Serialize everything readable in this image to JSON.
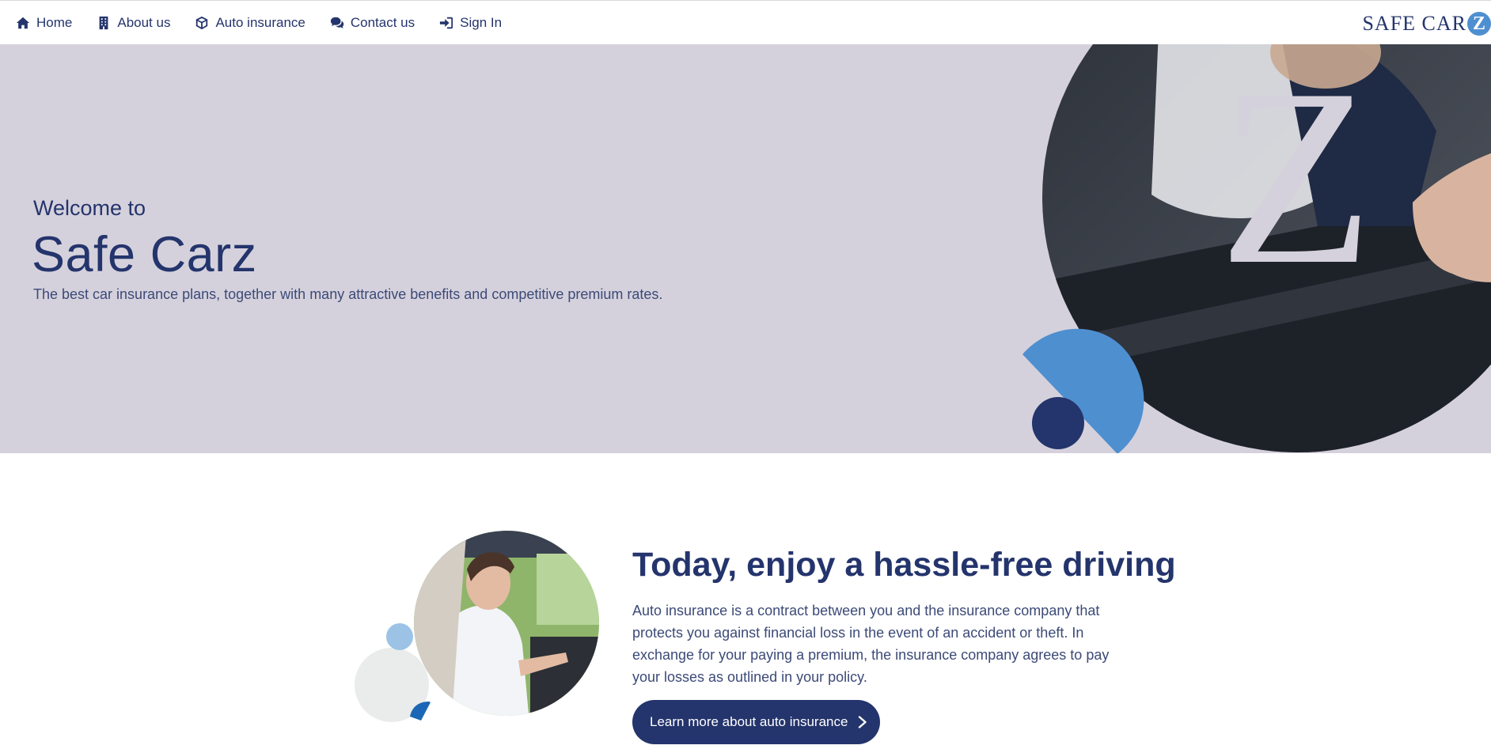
{
  "nav": {
    "items": [
      {
        "label": "Home",
        "icon": "home-icon"
      },
      {
        "label": "About us",
        "icon": "building-icon"
      },
      {
        "label": "Auto insurance",
        "icon": "cube-icon"
      },
      {
        "label": "Contact us",
        "icon": "comments-icon"
      },
      {
        "label": "Sign In",
        "icon": "sign-in-icon"
      }
    ]
  },
  "logo": {
    "text": "SAFE CAR",
    "badge": "Z"
  },
  "hero": {
    "welcome": "Welcome to",
    "title": "Safe Carz",
    "subtitle": "The best car insurance plans, together with many attractive benefits and competitive premium rates."
  },
  "section": {
    "title": "Today, enjoy a hassle-free driving",
    "body": "Auto insurance is a contract between you and the insurance company that protects you against financial loss in the event of an accident or theft. In exchange for your paying a premium, the insurance company agrees to pay your losses as outlined in your policy.",
    "cta_label": "Learn more about auto insurance"
  },
  "colors": {
    "navy": "#24346c",
    "hero_bg": "#d5d1dc",
    "accent_blue": "#4e8fd0",
    "light_blue": "#9cc3e6"
  }
}
